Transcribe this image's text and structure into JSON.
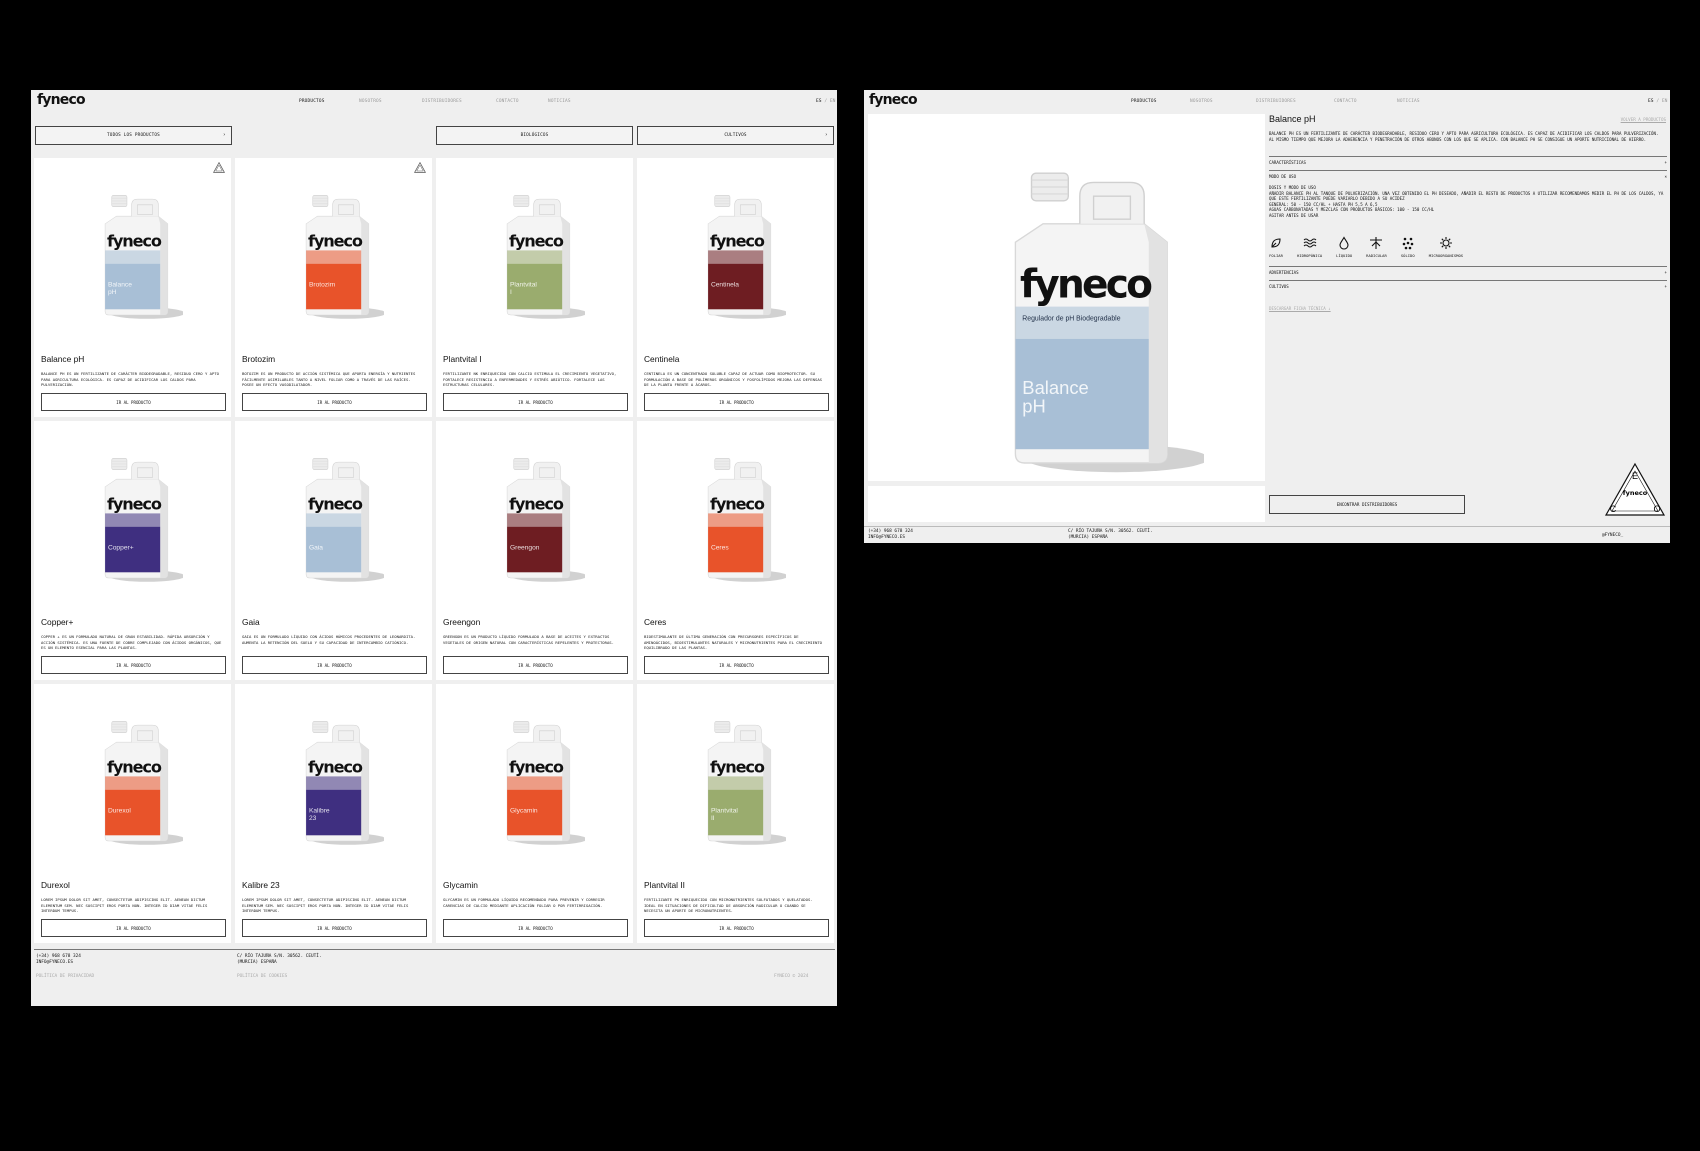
{
  "brand": "fyneco",
  "nav": [
    "Productos",
    "Nosotros",
    "Distribuidores",
    "Contacto",
    "Noticias"
  ],
  "lang": {
    "es": "ES",
    "sep": "/",
    "en": "EN"
  },
  "filters": {
    "all_products": "Todos los productos",
    "biologicos": "Biológicos",
    "cultivos": "Cultivos"
  },
  "products": [
    {
      "name": "Balance pH",
      "desc": "Balance pH es un fertilizante de carácter biodegradable, residuo cero y apto para agricultura ecológica. Es capaz de acidificar los caldos para pulverización.",
      "color": "#a8bfd6",
      "eco": true
    },
    {
      "name": "Brotozim",
      "desc": "Botozim es un producto de acción sistémica que aporta energía y nutrientes fácilmente asimilables tanto a nivel foliar como a través de las raíces. Posee un efecto vasodilatador.",
      "color": "#e8532a",
      "eco": true
    },
    {
      "name": "Plantvital I",
      "desc": "Fertilizante NK enriquecido con calcio estimula el crecimiento vegetativo, fortalece resistencia a enfermedades y estrés abiótico. Fortalece las estructuras celulares.",
      "color": "#9aac6e",
      "eco": false
    },
    {
      "name": "Centinela",
      "desc": "Centinela es un concentrado soluble capaz de actuar como bioprotector. Su formulación a base de polímeros orgánicos y fosfolípidos mejora las defensas de la planta frente a ácaros.",
      "color": "#6e1d22",
      "eco": false
    },
    {
      "name": "Copper+",
      "desc": "Copper + es un formulado natural de gran estabilidad. Rápida absorción y acción sistémica. Es una fuente de cobre complejado con ácidos orgánicos, que es un elemento esencial para las plantas.",
      "color": "#3f2f80",
      "eco": false
    },
    {
      "name": "Gaia",
      "desc": "Gaia es un formulado líquido con ácidos húmicos procedentes de leonardita. Aumenta la retención del suelo y su capacidad de intercambio catiónico.",
      "color": "#a8bfd6",
      "eco": false
    },
    {
      "name": "Greengon",
      "desc": "Greengon es un producto líquido formulado a base de aceites y extractos vegetales de origen natural con características repelentes y protectoras.",
      "color": "#6e1d22",
      "eco": false
    },
    {
      "name": "Ceres",
      "desc": "Bioestimulante de última generación con precursores específicos de aminoácidos, bioestimulantes naturales y micronutrientes para el crecimiento equilibrado de las plantas.",
      "color": "#e8532a",
      "eco": false
    },
    {
      "name": "Durexol",
      "desc": "Lorem ipsum dolor sit amet, consectetur adipiscing elit. Aenean dictum elementum sem. Nec suscipit eros porta non. Integer id diam vitae felis interdum tempus.",
      "color": "#e8532a",
      "eco": false
    },
    {
      "name": "Kalibre 23",
      "desc": "Lorem ipsum dolor sit amet, consectetur adipiscing elit. Aenean dictum elementum sem. Nec suscipit eros porta non. Integer id diam vitae felis interdum tempus.",
      "color": "#3f2f80",
      "eco": false
    },
    {
      "name": "Glycamin",
      "desc": "Glycamin es un formulado líquido recomendado para prevenir y corregir carencias de calcio mediante aplicación foliar o por fertirrigación.",
      "color": "#e8532a",
      "eco": false
    },
    {
      "name": "Plantvital II",
      "desc": "Fertilizante PK enriquecido con micronutrientes sulfatados y quelatados. Ideal en situaciones de dificultad de absorción radicular o cuando se necesita un aporte de micronutrientes.",
      "color": "#9aac6e",
      "eco": false
    }
  ],
  "card_button": "Ir al producto",
  "footer": {
    "phone": "(+34) 968 678 324",
    "email": "info@fyneco.es",
    "address1": "C/ Río Tajuña S/N. 30562. Ceutí.",
    "address2": "(Murcia) España",
    "privacy": "Política de privacidad",
    "cookies": "Política de cookies",
    "credit": "Fyneco © 2024",
    "social": "@fyneco_"
  },
  "detail": {
    "title": "Balance pH",
    "back": "Volver a productos",
    "desc": "Balance pH es un fertilizante de carácter biodegradable, residuo cero y apto para agricultura ecológica. Es capaz de acidificar los caldos para pulverización. Al mismo tiempo que mejora la adherencia y penetración de otros abonos con los que se aplica. Con Balance pH se consigue un aporte nutricional de hierro.",
    "acc_features": "Características",
    "acc_mode": "Modo de uso",
    "mode_lines": [
      "Dosis y modo de uso",
      "Añadir Balance pH al tanque de pulverización. Una vez obtenido el pH deseado, añadir el resto de productos a utilizar recomendamos medir el pH de los caldos, ya que este fertilizante puede variarlo debido a su acidez",
      "General: 50 - 150 cc/hl + hasta pH 5,5 a 6,5",
      "Aguas carbonatadas y mezclas con productos básicos: 100 - 150 cc/hl",
      "Agitar antes de usar"
    ],
    "uses": [
      "Foliar",
      "Hidropónica",
      "Líquido",
      "Radicular",
      "Sólido",
      "Microorganismos"
    ],
    "acc_warnings": "Advertencias",
    "acc_crops": "Cultivos",
    "sheet_link": "Descargar ficha técnica ↓",
    "dist_button": "Encontrar distribuidores",
    "label_top": "Regulador de pH Biodegradable",
    "label_name": "Balance pH"
  },
  "eco_seal": {
    "letters": [
      "E",
      "C",
      "O"
    ],
    "brand": "fyneco"
  },
  "colors": {
    "panel": "#efefef",
    "card": "#ffffff",
    "text": "#111111",
    "muted": "#999999"
  }
}
